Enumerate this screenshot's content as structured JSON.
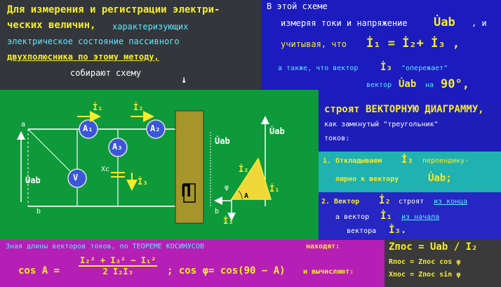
{
  "top_left": {
    "line1": "Для измерения и регистрации электри-",
    "line2a": "ческих величин,",
    "line2b": " характеризующих",
    "line3": "электрическое состояние пассивного",
    "line4": "двухполюсника по этому методу,",
    "line5": "собирают схему"
  },
  "top_right": {
    "line1": "В этой схеме",
    "line2": "измеряя токи и напряжение",
    "line2_sym": "U̇ab",
    "line2_end": ", и",
    "line3": "учитывая, что",
    "line3_eq": "İ₁ = İ₂+ İ₃ ,",
    "line4": "а также, что вектор",
    "line4_sym": "İ₃",
    "line4_end": "\"опережает\"",
    "line5": "вектор",
    "line5_sym": "U̇ab",
    "line5_end": "на",
    "line5_val": "90°,"
  },
  "right_mid": {
    "line1": "строят ВЕКТОРНУЮ ДИАГРАММУ,",
    "line2": "как замкнутый \"треугольник\"",
    "line3": "токов:"
  },
  "step1": {
    "line1a": "1. Откладываем",
    "line1_sym": "İ₃",
    "line1b": "перпендику-",
    "line2a": "лярно к вектору",
    "line2_sym": "U̇ab;"
  },
  "step2": {
    "line1a": "2. Вектор",
    "line1_sym": "İ₂",
    "line1b": "строят",
    "line1c": "из конца",
    "line2a": "а вектор",
    "line2_sym": "İ₁",
    "line2b": "из начала",
    "line3a": "вектора",
    "line3_sym": "İ₃."
  },
  "diagram": {
    "A1": "A₁",
    "A2": "A₂",
    "A3": "A₃",
    "V": "V",
    "I1": "İ₁",
    "I2": "İ₂",
    "I3": "İ₃",
    "Uab_left": "U̇ab",
    "Uab_right": "U̇ab",
    "Uab_vec": "U̇ab",
    "Xc": "Xc",
    "P": "П",
    "a_top": "a",
    "b_bot": "b",
    "b_bot2": "b",
    "vec_I1": "İ₁",
    "vec_I2": "İ₂",
    "vec_I3": "İ₃",
    "phi": "φ",
    "A": "A"
  },
  "bottom": {
    "line1a": "Зная длины векторов токов, по ТЕОРЕМЕ КОСИНУСОВ",
    "line1b": "находят:",
    "cos_A": "cos A =",
    "num": "I₂² + I₃² − I₁²",
    "den": "2 I₂I₃",
    "cos_phi": "; cos φ= cos(90 − A)",
    "tail": "и вычисляют:"
  },
  "formulas": {
    "z": "Zпос = Uab / I₂",
    "r": "Rпос = Zпос cos φ",
    "x": "Xпос = Zпос sin φ"
  },
  "colors": {
    "yellow": "#f6ec2e",
    "cyan": "#5ee8ff",
    "green": "#0e9a3a",
    "blue": "#1b1bbe",
    "olive": "#a5952a"
  }
}
